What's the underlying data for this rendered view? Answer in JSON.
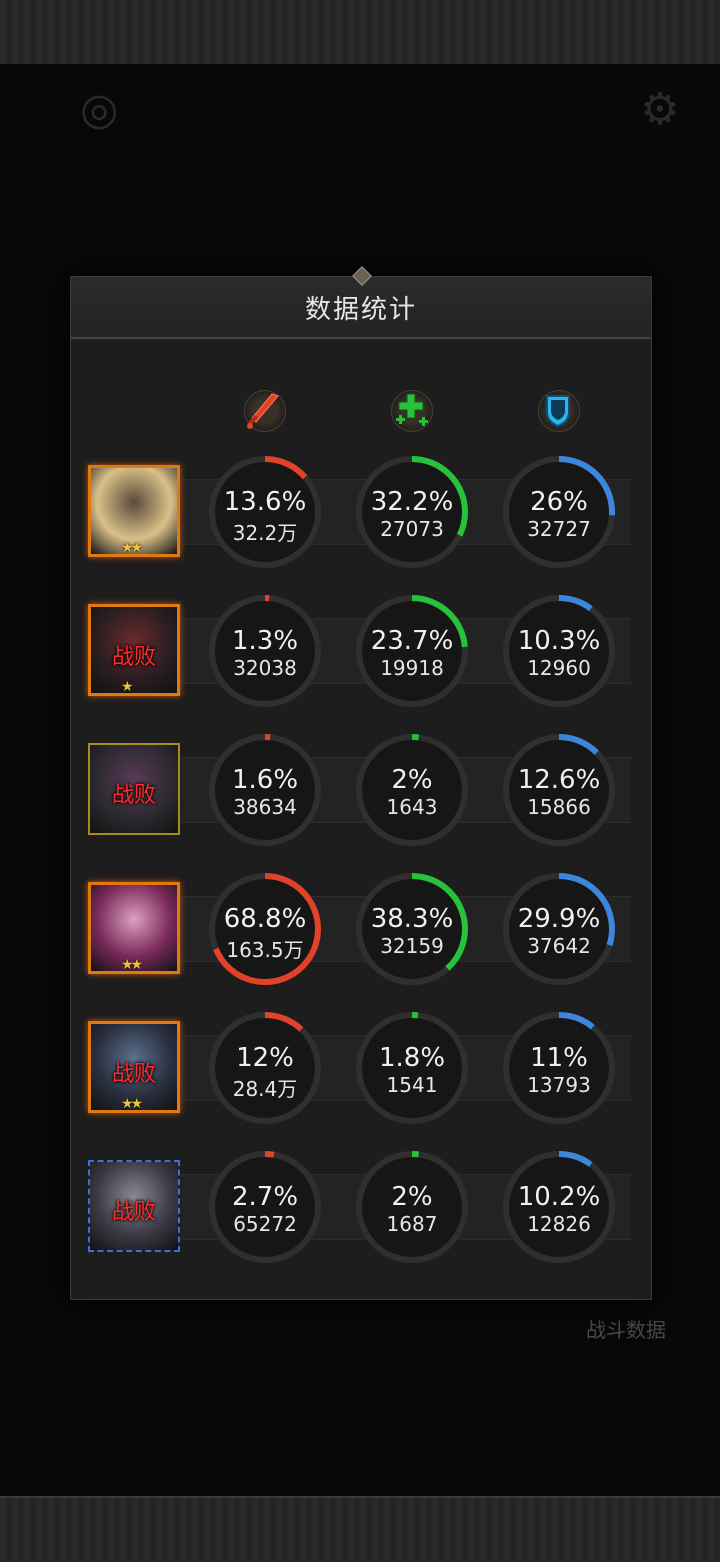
{
  "panel": {
    "title": "数据统计"
  },
  "background": {
    "battle_data_label": "战斗数据"
  },
  "columns": [
    {
      "icon": "sword-damage-icon",
      "color": "#e2412a"
    },
    {
      "icon": "heal-cross-icon",
      "color": "#27c23a"
    },
    {
      "icon": "shield-icon",
      "color": "#3d86db"
    }
  ],
  "heroes": [
    {
      "frame": "orange",
      "stars": "★★",
      "defeated": "",
      "damage": {
        "pct": "13.6%",
        "value": "32.2万",
        "fraction": 0.136
      },
      "heal": {
        "pct": "32.2%",
        "value": "27073",
        "fraction": 0.322
      },
      "shield": {
        "pct": "26%",
        "value": "32727",
        "fraction": 0.26
      }
    },
    {
      "frame": "orange",
      "stars": "★",
      "defeated": "战败",
      "damage": {
        "pct": "1.3%",
        "value": "32038",
        "fraction": 0.013
      },
      "heal": {
        "pct": "23.7%",
        "value": "19918",
        "fraction": 0.237
      },
      "shield": {
        "pct": "10.3%",
        "value": "12960",
        "fraction": 0.103
      }
    },
    {
      "frame": "yellow",
      "stars": "",
      "defeated": "战败",
      "damage": {
        "pct": "1.6%",
        "value": "38634",
        "fraction": 0.016
      },
      "heal": {
        "pct": "2%",
        "value": "1643",
        "fraction": 0.02
      },
      "shield": {
        "pct": "12.6%",
        "value": "15866",
        "fraction": 0.126
      }
    },
    {
      "frame": "orange",
      "stars": "★★",
      "defeated": "",
      "damage": {
        "pct": "68.8%",
        "value": "163.5万",
        "fraction": 0.688
      },
      "heal": {
        "pct": "38.3%",
        "value": "32159",
        "fraction": 0.383
      },
      "shield": {
        "pct": "29.9%",
        "value": "37642",
        "fraction": 0.299
      }
    },
    {
      "frame": "orange",
      "stars": "★★",
      "defeated": "战败",
      "damage": {
        "pct": "12%",
        "value": "28.4万",
        "fraction": 0.12
      },
      "heal": {
        "pct": "1.8%",
        "value": "1541",
        "fraction": 0.018
      },
      "shield": {
        "pct": "11%",
        "value": "13793",
        "fraction": 0.11
      }
    },
    {
      "frame": "blue",
      "stars": "",
      "defeated": "战败",
      "damage": {
        "pct": "2.7%",
        "value": "65272",
        "fraction": 0.027
      },
      "heal": {
        "pct": "2%",
        "value": "1687",
        "fraction": 0.02
      },
      "shield": {
        "pct": "10.2%",
        "value": "12826",
        "fraction": 0.102
      }
    }
  ]
}
